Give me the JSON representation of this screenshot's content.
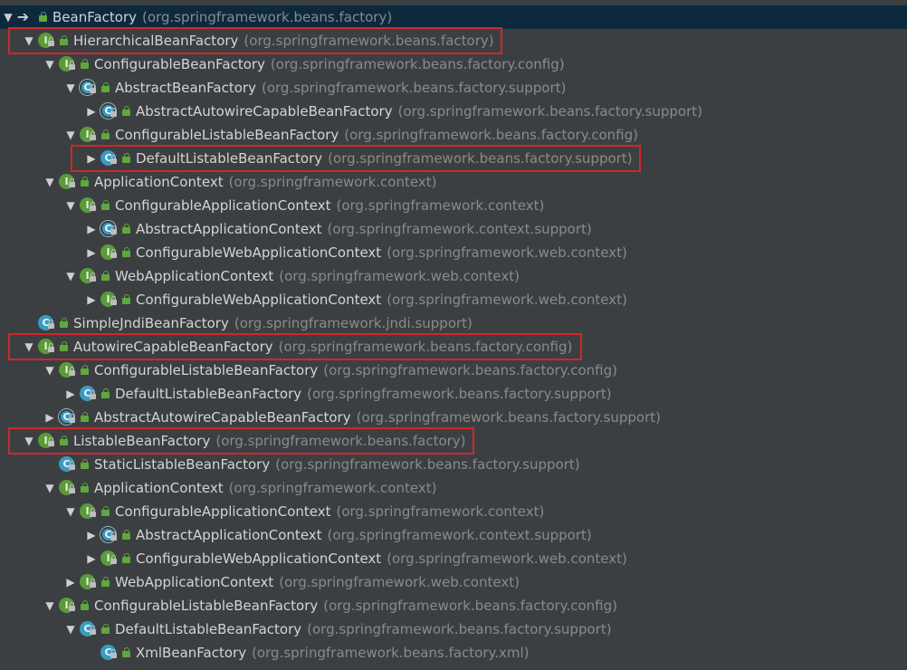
{
  "tree": [
    {
      "arrow": "down",
      "icon": "interface-arrow",
      "name": "BeanFactory",
      "pkg": "(org.springframework.beans.factory)",
      "level": 0,
      "selected": true
    },
    {
      "arrow": "down",
      "icon": "interface",
      "name": "HierarchicalBeanFactory",
      "pkg": "(org.springframework.beans.factory)",
      "level": 1
    },
    {
      "arrow": "down",
      "icon": "interface",
      "name": "ConfigurableBeanFactory",
      "pkg": "(org.springframework.beans.factory.config)",
      "level": 2
    },
    {
      "arrow": "down",
      "icon": "abstract-class",
      "name": "AbstractBeanFactory",
      "pkg": "(org.springframework.beans.factory.support)",
      "level": 3
    },
    {
      "arrow": "right",
      "icon": "abstract-class",
      "name": "AbstractAutowireCapableBeanFactory",
      "pkg": "(org.springframework.beans.factory.support)",
      "level": 4
    },
    {
      "arrow": "down",
      "icon": "interface",
      "name": "ConfigurableListableBeanFactory",
      "pkg": "(org.springframework.beans.factory.config)",
      "level": 3
    },
    {
      "arrow": "right",
      "icon": "class",
      "name": "DefaultListableBeanFactory",
      "pkg": "(org.springframework.beans.factory.support)",
      "level": 4
    },
    {
      "arrow": "down",
      "icon": "interface",
      "name": "ApplicationContext",
      "pkg": "(org.springframework.context)",
      "level": 2
    },
    {
      "arrow": "down",
      "icon": "interface",
      "name": "ConfigurableApplicationContext",
      "pkg": "(org.springframework.context)",
      "level": 3
    },
    {
      "arrow": "right",
      "icon": "abstract-class",
      "name": "AbstractApplicationContext",
      "pkg": "(org.springframework.context.support)",
      "level": 4
    },
    {
      "arrow": "right",
      "icon": "interface",
      "name": "ConfigurableWebApplicationContext",
      "pkg": "(org.springframework.web.context)",
      "level": 4
    },
    {
      "arrow": "down",
      "icon": "interface",
      "name": "WebApplicationContext",
      "pkg": "(org.springframework.web.context)",
      "level": 3
    },
    {
      "arrow": "right",
      "icon": "interface",
      "name": "ConfigurableWebApplicationContext",
      "pkg": "(org.springframework.web.context)",
      "level": 4
    },
    {
      "arrow": "none",
      "icon": "class",
      "name": "SimpleJndiBeanFactory",
      "pkg": "(org.springframework.jndi.support)",
      "level": 1
    },
    {
      "arrow": "down",
      "icon": "interface",
      "name": "AutowireCapableBeanFactory",
      "pkg": "(org.springframework.beans.factory.config)",
      "level": 1
    },
    {
      "arrow": "down",
      "icon": "interface",
      "name": "ConfigurableListableBeanFactory",
      "pkg": "(org.springframework.beans.factory.config)",
      "level": 2
    },
    {
      "arrow": "right",
      "icon": "class",
      "name": "DefaultListableBeanFactory",
      "pkg": "(org.springframework.beans.factory.support)",
      "level": 3
    },
    {
      "arrow": "right",
      "icon": "abstract-class",
      "name": "AbstractAutowireCapableBeanFactory",
      "pkg": "(org.springframework.beans.factory.support)",
      "level": 2
    },
    {
      "arrow": "down",
      "icon": "interface",
      "name": "ListableBeanFactory",
      "pkg": "(org.springframework.beans.factory)",
      "level": 1
    },
    {
      "arrow": "none",
      "icon": "class",
      "name": "StaticListableBeanFactory",
      "pkg": "(org.springframework.beans.factory.support)",
      "level": 2
    },
    {
      "arrow": "down",
      "icon": "interface",
      "name": "ApplicationContext",
      "pkg": "(org.springframework.context)",
      "level": 2
    },
    {
      "arrow": "down",
      "icon": "interface",
      "name": "ConfigurableApplicationContext",
      "pkg": "(org.springframework.context)",
      "level": 3
    },
    {
      "arrow": "right",
      "icon": "abstract-class",
      "name": "AbstractApplicationContext",
      "pkg": "(org.springframework.context.support)",
      "level": 4
    },
    {
      "arrow": "right",
      "icon": "interface",
      "name": "ConfigurableWebApplicationContext",
      "pkg": "(org.springframework.web.context)",
      "level": 4
    },
    {
      "arrow": "right",
      "icon": "interface",
      "name": "WebApplicationContext",
      "pkg": "(org.springframework.web.context)",
      "level": 3
    },
    {
      "arrow": "down",
      "icon": "interface",
      "name": "ConfigurableListableBeanFactory",
      "pkg": "(org.springframework.beans.factory.config)",
      "level": 2
    },
    {
      "arrow": "down",
      "icon": "class",
      "name": "DefaultListableBeanFactory",
      "pkg": "(org.springframework.beans.factory.support)",
      "level": 3
    },
    {
      "arrow": "none",
      "icon": "class",
      "name": "XmlBeanFactory",
      "pkg": "(org.springframework.beans.factory.xml)",
      "level": 4
    }
  ],
  "highlight_rows": [
    1,
    6,
    14,
    18
  ],
  "colors": {
    "background": "#3c3f41",
    "selected_row": "#0d293e",
    "name_text": "#d4d4d4",
    "package_text": "#8a8a8a",
    "highlight_border": "#d3262a",
    "interface_icon": "#5b9b3a",
    "class_icon": "#3a9bbf"
  }
}
